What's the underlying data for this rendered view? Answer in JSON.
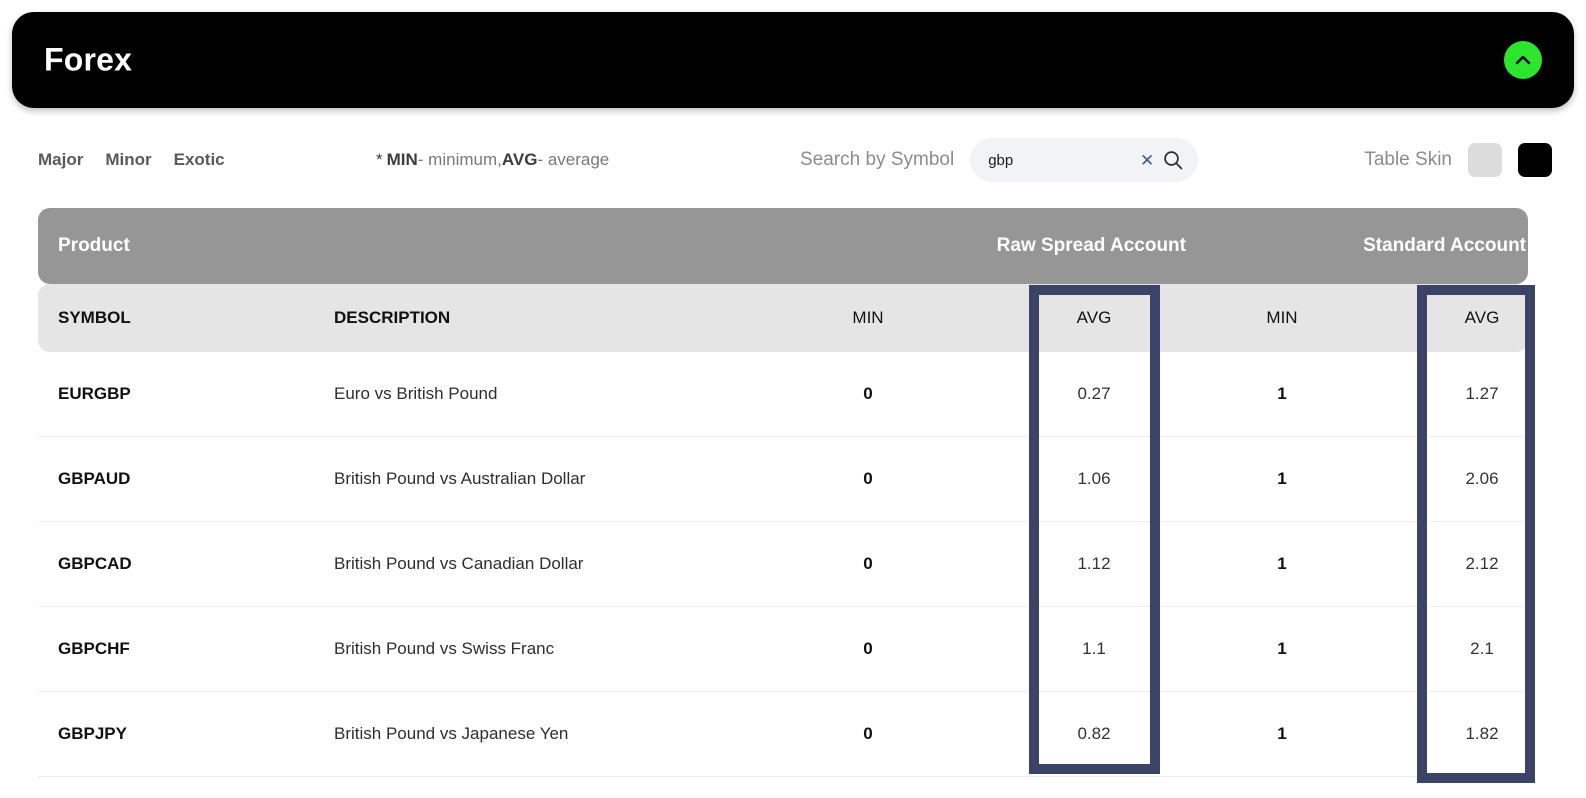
{
  "header": {
    "title": "Forex",
    "collapse_icon": "chevron-up-icon",
    "collapse_color": "#2ee52e"
  },
  "toolbar": {
    "tabs": [
      {
        "label": "Major"
      },
      {
        "label": "Minor"
      },
      {
        "label": "Exotic"
      }
    ],
    "legend": {
      "star": "*",
      "min_abbr": "MIN",
      "min_text": " - minimum, ",
      "avg_abbr": "AVG",
      "avg_text": " - average"
    },
    "search": {
      "label": "Search by Symbol",
      "value": "gbp",
      "placeholder": "",
      "clear_icon": "close-icon",
      "search_icon": "search-icon",
      "clear_color": "#3f5b8f"
    },
    "table_skin": {
      "label": "Table Skin",
      "options": [
        {
          "name": "light",
          "color": "#dcdcdc"
        },
        {
          "name": "dark",
          "color": "#000000"
        }
      ]
    }
  },
  "table": {
    "group_headers": {
      "product": "Product",
      "raw_spread_account": "Raw Spread Account",
      "standard_account": "Standard Account"
    },
    "columns": {
      "symbol": "SYMBOL",
      "description": "DESCRIPTION",
      "raw_min": "MIN",
      "raw_avg": "AVG",
      "std_min": "MIN",
      "std_avg": "AVG"
    },
    "rows": [
      {
        "symbol": "EURGBP",
        "description": "Euro vs British Pound",
        "raw_min": "0",
        "raw_avg": "0.27",
        "std_min": "1",
        "std_avg": "1.27"
      },
      {
        "symbol": "GBPAUD",
        "description": "British Pound vs Australian Dollar",
        "raw_min": "0",
        "raw_avg": "1.06",
        "std_min": "1",
        "std_avg": "2.06"
      },
      {
        "symbol": "GBPCAD",
        "description": "British Pound vs Canadian Dollar",
        "raw_min": "0",
        "raw_avg": "1.12",
        "std_min": "1",
        "std_avg": "2.12"
      },
      {
        "symbol": "GBPCHF",
        "description": "British Pound vs Swiss Franc",
        "raw_min": "0",
        "raw_avg": "1.1",
        "std_min": "1",
        "std_avg": "2.1"
      },
      {
        "symbol": "GBPJPY",
        "description": "British Pound vs Japanese Yen",
        "raw_min": "0",
        "raw_avg": "0.82",
        "std_min": "1",
        "std_avg": "1.82"
      }
    ]
  },
  "highlights": {
    "color": "#3b4467",
    "targets": [
      "raw_avg_column",
      "std_avg_column"
    ]
  }
}
